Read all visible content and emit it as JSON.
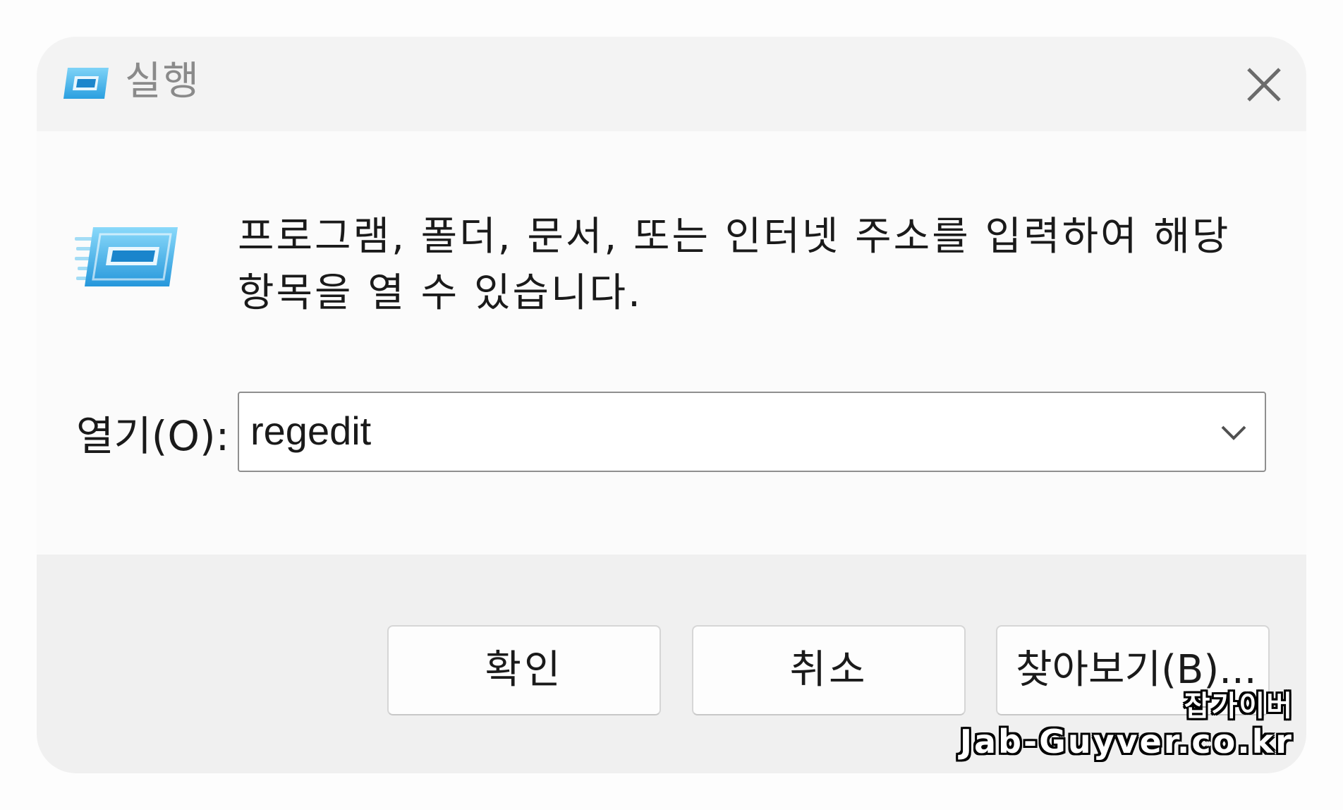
{
  "window": {
    "title": "실행",
    "title_icon": "run-app-icon",
    "close_icon": "close-icon"
  },
  "content": {
    "icon": "run-app-icon",
    "description": "프로그램, 폴더, 문서, 또는 인터넷 주소를 입력하여 해당 항목을 열 수 있습니다.",
    "open_label": "열기(O):",
    "open_value": "regedit",
    "dropdown_icon": "chevron-down-icon"
  },
  "buttons": {
    "ok": "확인",
    "cancel": "취소",
    "browse": "찾아보기(B)..."
  },
  "watermark": {
    "line1": "잡가이버",
    "line2": "Jab-Guyver.co.kr"
  },
  "colors": {
    "accent": "#2aa3e4",
    "titlebar_bg": "#f3f3f3",
    "footer_bg": "#f0f0f0"
  }
}
